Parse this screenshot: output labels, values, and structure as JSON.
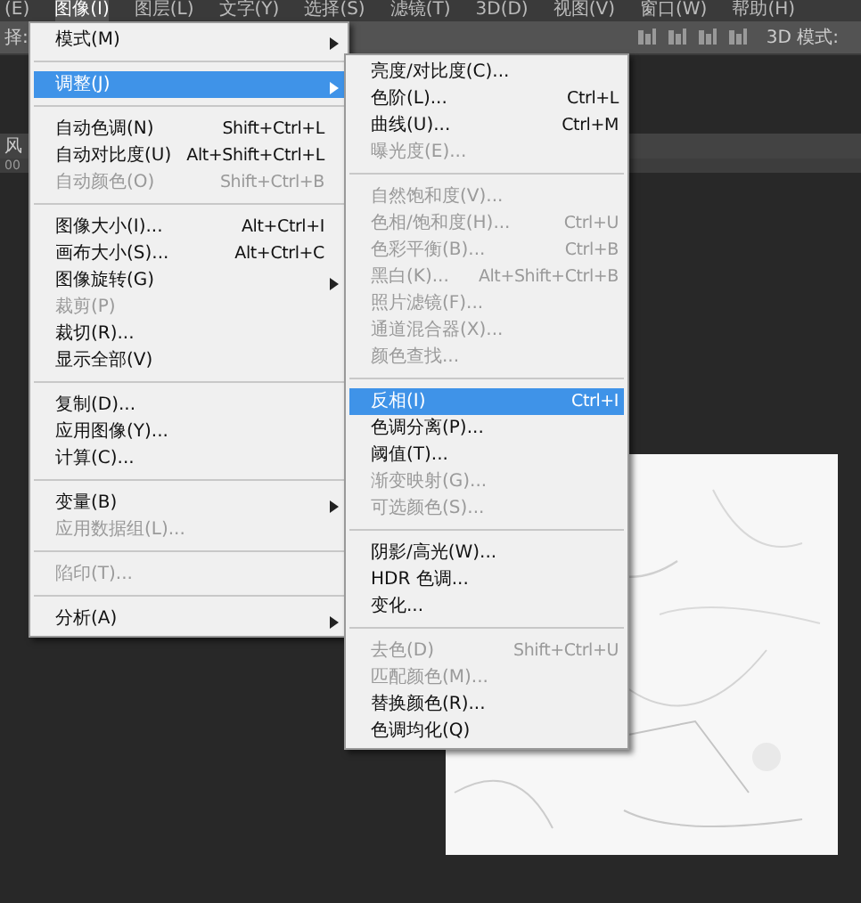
{
  "menubar": {
    "items": [
      {
        "label": "(E)",
        "selected": false
      },
      {
        "label": "图像(I)",
        "selected": true
      },
      {
        "label": "图层(L)",
        "selected": false
      },
      {
        "label": "文字(Y)",
        "selected": false
      },
      {
        "label": "选择(S)",
        "selected": false
      },
      {
        "label": "滤镜(T)",
        "selected": false
      },
      {
        "label": "3D(D)",
        "selected": false
      },
      {
        "label": "视图(V)",
        "selected": false
      },
      {
        "label": "窗口(W)",
        "selected": false
      },
      {
        "label": "帮助(H)",
        "selected": false
      }
    ]
  },
  "options_bar": {
    "left_label": "择:",
    "mode_label": "3D 模式:"
  },
  "document_tab": {
    "title": "风"
  },
  "ruler": {
    "label": "00"
  },
  "image_menu": {
    "items": [
      {
        "kind": "item",
        "label": "模式(M)",
        "disabled": false,
        "selected": false,
        "submenu": true
      },
      {
        "kind": "separator"
      },
      {
        "kind": "item",
        "label": "调整(J)",
        "disabled": false,
        "selected": true,
        "submenu": true
      },
      {
        "kind": "separator"
      },
      {
        "kind": "item",
        "label": "自动色调(N)",
        "shortcut": "Shift+Ctrl+L",
        "disabled": false,
        "selected": false,
        "submenu": false
      },
      {
        "kind": "item",
        "label": "自动对比度(U)",
        "shortcut": "Alt+Shift+Ctrl+L",
        "disabled": false,
        "selected": false,
        "submenu": false
      },
      {
        "kind": "item",
        "label": "自动颜色(O)",
        "shortcut": "Shift+Ctrl+B",
        "disabled": true,
        "selected": false,
        "submenu": false
      },
      {
        "kind": "separator"
      },
      {
        "kind": "item",
        "label": "图像大小(I)...",
        "shortcut": "Alt+Ctrl+I",
        "disabled": false,
        "selected": false,
        "submenu": false
      },
      {
        "kind": "item",
        "label": "画布大小(S)...",
        "shortcut": "Alt+Ctrl+C",
        "disabled": false,
        "selected": false,
        "submenu": false
      },
      {
        "kind": "item",
        "label": "图像旋转(G)",
        "disabled": false,
        "selected": false,
        "submenu": true
      },
      {
        "kind": "item",
        "label": "裁剪(P)",
        "disabled": true,
        "selected": false,
        "submenu": false
      },
      {
        "kind": "item",
        "label": "裁切(R)...",
        "disabled": false,
        "selected": false,
        "submenu": false
      },
      {
        "kind": "item",
        "label": "显示全部(V)",
        "disabled": false,
        "selected": false,
        "submenu": false
      },
      {
        "kind": "separator"
      },
      {
        "kind": "item",
        "label": "复制(D)...",
        "disabled": false,
        "selected": false,
        "submenu": false
      },
      {
        "kind": "item",
        "label": "应用图像(Y)...",
        "disabled": false,
        "selected": false,
        "submenu": false
      },
      {
        "kind": "item",
        "label": "计算(C)...",
        "disabled": false,
        "selected": false,
        "submenu": false
      },
      {
        "kind": "separator"
      },
      {
        "kind": "item",
        "label": "变量(B)",
        "disabled": false,
        "selected": false,
        "submenu": true
      },
      {
        "kind": "item",
        "label": "应用数据组(L)...",
        "disabled": true,
        "selected": false,
        "submenu": false
      },
      {
        "kind": "separator"
      },
      {
        "kind": "item",
        "label": "陷印(T)...",
        "disabled": true,
        "selected": false,
        "submenu": false
      },
      {
        "kind": "separator"
      },
      {
        "kind": "item",
        "label": "分析(A)",
        "disabled": false,
        "selected": false,
        "submenu": true
      }
    ]
  },
  "adjust_menu": {
    "items": [
      {
        "kind": "item",
        "label": "亮度/对比度(C)...",
        "disabled": false,
        "selected": false
      },
      {
        "kind": "item",
        "label": "色阶(L)...",
        "shortcut": "Ctrl+L",
        "disabled": false,
        "selected": false
      },
      {
        "kind": "item",
        "label": "曲线(U)...",
        "shortcut": "Ctrl+M",
        "disabled": false,
        "selected": false
      },
      {
        "kind": "item",
        "label": "曝光度(E)...",
        "disabled": true,
        "selected": false
      },
      {
        "kind": "separator"
      },
      {
        "kind": "item",
        "label": "自然饱和度(V)...",
        "disabled": true,
        "selected": false
      },
      {
        "kind": "item",
        "label": "色相/饱和度(H)...",
        "shortcut": "Ctrl+U",
        "disabled": true,
        "selected": false
      },
      {
        "kind": "item",
        "label": "色彩平衡(B)...",
        "shortcut": "Ctrl+B",
        "disabled": true,
        "selected": false
      },
      {
        "kind": "item",
        "label": "黑白(K)...",
        "shortcut": "Alt+Shift+Ctrl+B",
        "disabled": true,
        "selected": false
      },
      {
        "kind": "item",
        "label": "照片滤镜(F)...",
        "disabled": true,
        "selected": false
      },
      {
        "kind": "item",
        "label": "通道混合器(X)...",
        "disabled": true,
        "selected": false
      },
      {
        "kind": "item",
        "label": "颜色查找...",
        "disabled": true,
        "selected": false
      },
      {
        "kind": "separator"
      },
      {
        "kind": "item",
        "label": "反相(I)",
        "shortcut": "Ctrl+I",
        "disabled": false,
        "selected": true
      },
      {
        "kind": "item",
        "label": "色调分离(P)...",
        "disabled": false,
        "selected": false
      },
      {
        "kind": "item",
        "label": "阈值(T)...",
        "disabled": false,
        "selected": false
      },
      {
        "kind": "item",
        "label": "渐变映射(G)...",
        "disabled": true,
        "selected": false
      },
      {
        "kind": "item",
        "label": "可选颜色(S)...",
        "disabled": true,
        "selected": false
      },
      {
        "kind": "separator"
      },
      {
        "kind": "item",
        "label": "阴影/高光(W)...",
        "disabled": false,
        "selected": false
      },
      {
        "kind": "item",
        "label": "HDR 色调...",
        "disabled": false,
        "selected": false
      },
      {
        "kind": "item",
        "label": "变化...",
        "disabled": false,
        "selected": false
      },
      {
        "kind": "separator"
      },
      {
        "kind": "item",
        "label": "去色(D)",
        "shortcut": "Shift+Ctrl+U",
        "disabled": true,
        "selected": false
      },
      {
        "kind": "item",
        "label": "匹配颜色(M)...",
        "disabled": true,
        "selected": false
      },
      {
        "kind": "item",
        "label": "替换颜色(R)...",
        "disabled": false,
        "selected": false
      },
      {
        "kind": "item",
        "label": "色调均化(Q)",
        "disabled": false,
        "selected": false
      }
    ]
  }
}
